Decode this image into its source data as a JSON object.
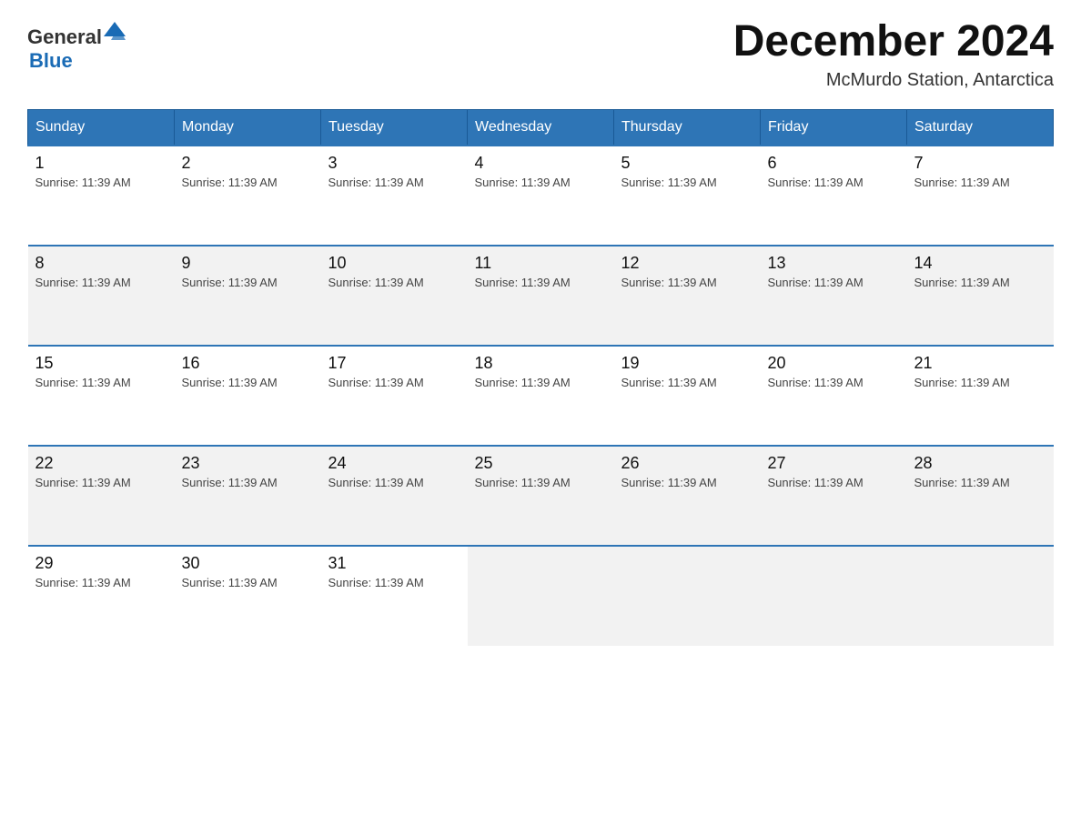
{
  "logo": {
    "text_general": "General",
    "text_blue": "Blue"
  },
  "header": {
    "month_year": "December 2024",
    "location": "McMurdo Station, Antarctica"
  },
  "days_of_week": [
    "Sunday",
    "Monday",
    "Tuesday",
    "Wednesday",
    "Thursday",
    "Friday",
    "Saturday"
  ],
  "sunrise": "Sunrise: 11:39 AM",
  "weeks": [
    [
      {
        "day": "1",
        "sunrise": "Sunrise: 11:39 AM"
      },
      {
        "day": "2",
        "sunrise": "Sunrise: 11:39 AM"
      },
      {
        "day": "3",
        "sunrise": "Sunrise: 11:39 AM"
      },
      {
        "day": "4",
        "sunrise": "Sunrise: 11:39 AM"
      },
      {
        "day": "5",
        "sunrise": "Sunrise: 11:39 AM"
      },
      {
        "day": "6",
        "sunrise": "Sunrise: 11:39 AM"
      },
      {
        "day": "7",
        "sunrise": "Sunrise: 11:39 AM"
      }
    ],
    [
      {
        "day": "8",
        "sunrise": "Sunrise: 11:39 AM"
      },
      {
        "day": "9",
        "sunrise": "Sunrise: 11:39 AM"
      },
      {
        "day": "10",
        "sunrise": "Sunrise: 11:39 AM"
      },
      {
        "day": "11",
        "sunrise": "Sunrise: 11:39 AM"
      },
      {
        "day": "12",
        "sunrise": "Sunrise: 11:39 AM"
      },
      {
        "day": "13",
        "sunrise": "Sunrise: 11:39 AM"
      },
      {
        "day": "14",
        "sunrise": "Sunrise: 11:39 AM"
      }
    ],
    [
      {
        "day": "15",
        "sunrise": "Sunrise: 11:39 AM"
      },
      {
        "day": "16",
        "sunrise": "Sunrise: 11:39 AM"
      },
      {
        "day": "17",
        "sunrise": "Sunrise: 11:39 AM"
      },
      {
        "day": "18",
        "sunrise": "Sunrise: 11:39 AM"
      },
      {
        "day": "19",
        "sunrise": "Sunrise: 11:39 AM"
      },
      {
        "day": "20",
        "sunrise": "Sunrise: 11:39 AM"
      },
      {
        "day": "21",
        "sunrise": "Sunrise: 11:39 AM"
      }
    ],
    [
      {
        "day": "22",
        "sunrise": "Sunrise: 11:39 AM"
      },
      {
        "day": "23",
        "sunrise": "Sunrise: 11:39 AM"
      },
      {
        "day": "24",
        "sunrise": "Sunrise: 11:39 AM"
      },
      {
        "day": "25",
        "sunrise": "Sunrise: 11:39 AM"
      },
      {
        "day": "26",
        "sunrise": "Sunrise: 11:39 AM"
      },
      {
        "day": "27",
        "sunrise": "Sunrise: 11:39 AM"
      },
      {
        "day": "28",
        "sunrise": "Sunrise: 11:39 AM"
      }
    ],
    [
      {
        "day": "29",
        "sunrise": "Sunrise: 11:39 AM"
      },
      {
        "day": "30",
        "sunrise": "Sunrise: 11:39 AM"
      },
      {
        "day": "31",
        "sunrise": "Sunrise: 11:39 AM"
      },
      null,
      null,
      null,
      null
    ]
  ]
}
